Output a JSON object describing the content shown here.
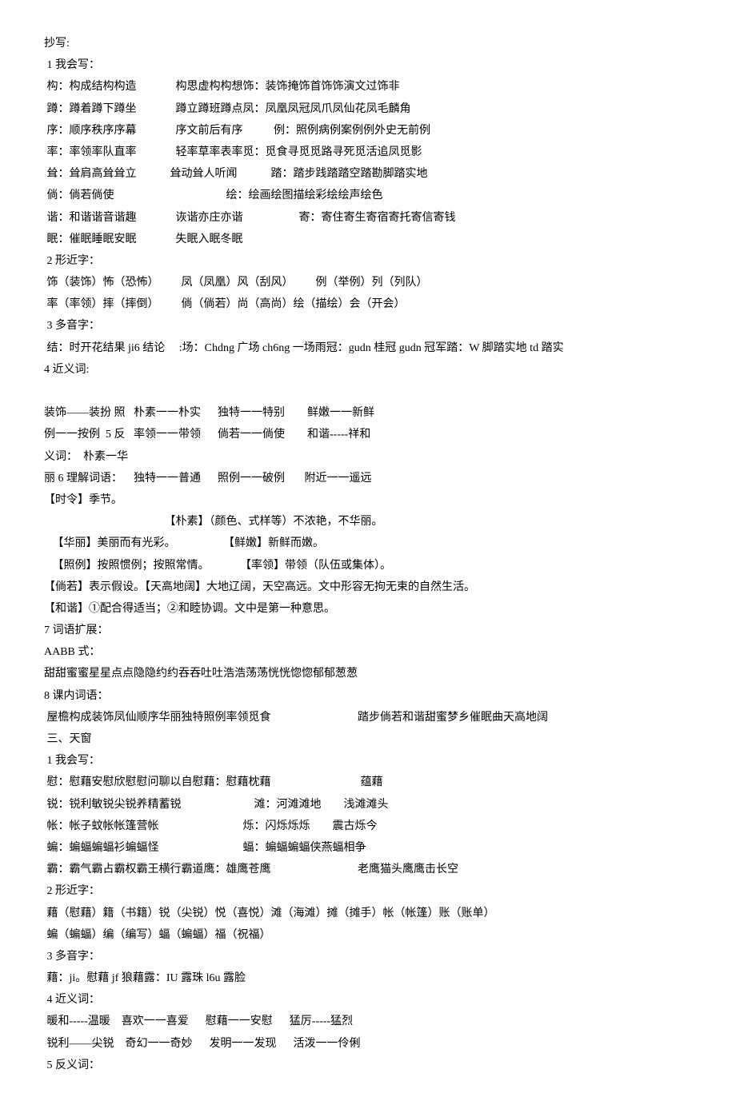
{
  "lines": [
    "抄写:",
    " 1 我会写：",
    " 构：构成结构构造              构思虚构构想饰：装饰掩饰首饰饰演文过饰非",
    " 蹲：蹲着蹲下蹲坐              蹲立蹲班蹲点凤：凤凰凤冠凤爪凤仙花凤毛麟角",
    " 序：顺序秩序序幕              序文前后有序           例：照例病例案例例外史无前例",
    " 率：率领率队直率              轻率草率表率觅：觅食寻觅觅路寻死觅活追凤觅影",
    " 耸：耸肩高耸耸立            耸动耸人听闻            踏：踏步践踏踏空踏勘脚踏实地",
    " 倘：倘若倘使                                        绘：绘画绘图描绘彩绘绘声绘色",
    " 谐：和谐谐音谐趣              诙谐亦庄亦谐                    寄：寄住寄生寄宿寄托寄信寄钱",
    " 眠：催眠睡眠安眠              失眠入眠冬眠",
    " 2 形近字：",
    " 饰（装饰）怖（恐怖）        凤（凤凰）风（刮风）        例（举例）列（列队）",
    " 率（率领）摔（摔倒）        倘（倘若）尚（高尚）绘（描绘）会（开会）",
    " 3 多音字：",
    " 结：时开花结果 ji6 结论     :场：Chdng 广场 ch6ng 一场雨冠：gudn 桂冠 gudn 冠军踏：W 脚踏实地 td 踏实",
    "4 近义词:",
    "",
    "装饰——装扮 照   朴素一一朴实      独特一一特别        鲜嫩一一新鲜",
    "例一一按例  5 反   率领一一带领      倘若一一倘使        和谐-----祥和",
    "义词：  朴素一华",
    "丽 6 理解词语：    独特一一普通      照例一一破例       附近一一遥远",
    "【时令】季节。",
    "                                           【朴素】（颜色、式样等）不浓艳，不华丽。",
    "   【华丽】美丽而有光彩。                 【鲜嫩】新鲜而嫩。",
    "   【照例】按照惯例；按照常情。           【率领】带领（队伍或集体）。",
    "【倘若】表示假设。【天高地阔】大地辽阔，天空高远。文中形容无拘无束的自然生活。",
    "【和谐】①配合得适当；②和睦协调。文中是第一种意思。",
    "7 词语扩展：",
    "AABB 式：",
    "甜甜蜜蜜星星点点隐隐约约吞吞吐吐浩浩荡荡恍恍惚惚郁郁葱葱",
    "8 课内词语：",
    " 屋檐构成装饰凤仙顺序华丽独特照例率领觅食                               踏步倘若和谐甜蜜梦乡催眠曲天高地阔",
    " 三、天窗",
    " 1 我会写：",
    " 慰：慰藉安慰欣慰慰问聊以自慰藉：慰藉枕藉                                蕴藉",
    " 锐：锐利敏锐尖锐养精蓄锐                          滩：河滩滩地        浅滩滩头",
    " 帐：帐子蚊帐帐篷营帐                              烁：闪烁烁烁        震古烁今",
    " 蝙：蝙蝠蝙蝠衫蝙蝠怪                              蝠：蝙蝠蝙蝠侠燕蝠相争",
    " 霸：霸气霸占霸权霸王横行霸道鹰：雄鹰苍鹰                               老鹰猫头鹰鹰击长空",
    " 2 形近字：",
    " 藉（慰藉）籍（书籍）锐（尖锐）悦（喜悦）滩（海滩）摊（摊手）帐（帐篷）账（账单）",
    " 蝙（蝙蝠）编（编写）蝠（蝙蝠）福（祝福）",
    " 3 多音字：",
    " 藉：ji。慰藉 jf 狼藉露：IU 露珠 l6u 露脸",
    " 4 近义词：",
    " 暖和-----温暖    喜欢一一喜爱      慰藉一一安慰      猛厉-----猛烈",
    " 锐利——尖锐    奇幻一一奇妙      发明一一发现      活泼一一伶俐",
    " 5 反义词："
  ]
}
